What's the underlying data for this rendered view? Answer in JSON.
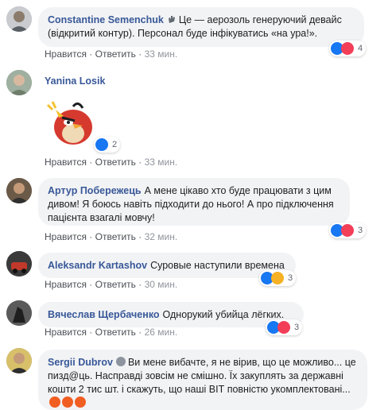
{
  "actions": {
    "like": "Нравится",
    "reply": "Ответить",
    "separator": "·"
  },
  "comments": [
    {
      "author": "Constantine Semenchuk",
      "text": "Це — аерозоль генеруючий девайс (відкритий контур). Персонал буде інфікуватись «на ура!».",
      "time": "33 мин.",
      "reaction_count": "4"
    },
    {
      "author": "Yanina Losik",
      "text": "",
      "time": "33 мин.",
      "reaction_count": "2",
      "sticker": "angry-red-bird-sticker"
    },
    {
      "author": "Артур Побережець",
      "text": "А мене цікаво хто буде працювати з цим дивом! Я боюсь навіть підходити до нього! А про підключення пацієнта взагалі мовчу!",
      "time": "32 мин.",
      "reaction_count": "3"
    },
    {
      "author": "Aleksandr Kartashov",
      "text": "Суровые наступили времена",
      "time": "30 мин.",
      "reaction_count": "3"
    },
    {
      "author": "Вячеслав Щербаченко",
      "text": "Однорукий убийца лёгких.",
      "time": "26 мин.",
      "reaction_count": "3"
    },
    {
      "author": "Sergii Dubrov",
      "text": "Ви мене вибачте, я не вірив, що це можливо... це пизд@ць. Насправді зовсім не смішно. Їх закуплять за державні кошти 2 тис шт. і скажуть, що наші ВІТ повністю укомплектовані...",
      "time": "",
      "reaction_count": ""
    }
  ]
}
